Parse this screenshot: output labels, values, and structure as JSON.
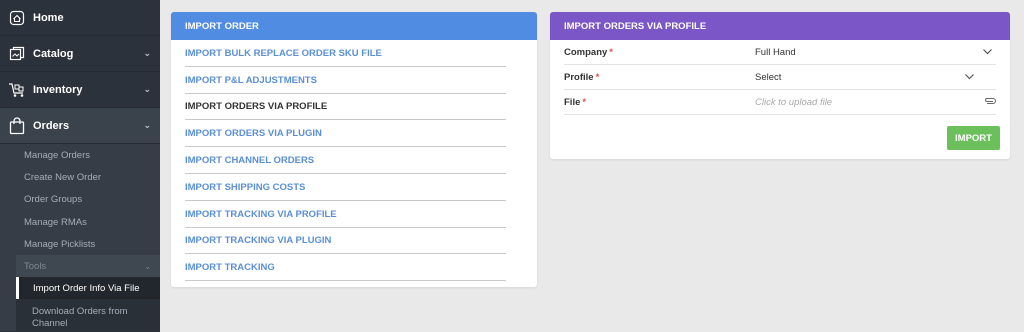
{
  "sidebar": {
    "items": [
      {
        "label": "Home",
        "icon": "home-icon"
      },
      {
        "label": "Catalog",
        "icon": "catalog-icon"
      },
      {
        "label": "Inventory",
        "icon": "inventory-icon"
      },
      {
        "label": "Orders",
        "icon": "shopping-bag-icon"
      }
    ],
    "orders_sub": [
      "Manage Orders",
      "Create New Order",
      "Order Groups",
      "Manage RMAs",
      "Manage Picklists"
    ],
    "tools_label": "Tools",
    "tools_items": [
      "Import Order Info Via File",
      "Download Orders from Channel"
    ]
  },
  "left_panel": {
    "title": "IMPORT ORDER",
    "links": [
      "IMPORT BULK REPLACE ORDER SKU FILE",
      "IMPORT P&L ADJUSTMENTS",
      "IMPORT ORDERS VIA PROFILE",
      "IMPORT ORDERS VIA PLUGIN",
      "IMPORT CHANNEL ORDERS",
      "IMPORT SHIPPING COSTS",
      "IMPORT TRACKING VIA PROFILE",
      "IMPORT TRACKING VIA PLUGIN",
      "IMPORT TRACKING"
    ]
  },
  "right_panel": {
    "title": "IMPORT ORDERS VIA PROFILE",
    "company_label": "Company",
    "company_value": "Full Hand",
    "profile_label": "Profile",
    "profile_value": "Select",
    "file_label": "File",
    "file_placeholder": "Click to upload file",
    "required_mark": "*",
    "import_label": "IMPORT"
  },
  "colors": {
    "sidebar_bg": "#2c323b",
    "left_header": "#4f8ce2",
    "right_header": "#7b56c7",
    "link_color": "#5b8fd6",
    "import_button": "#6cc05b",
    "required": "#d9534f"
  }
}
